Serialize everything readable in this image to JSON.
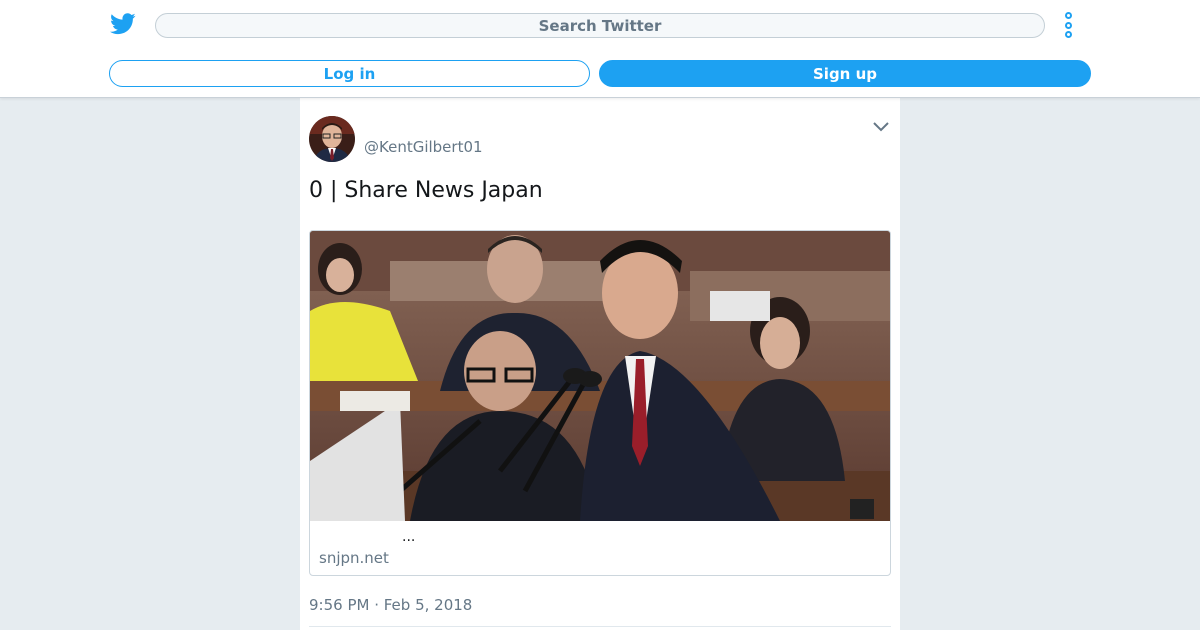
{
  "header": {
    "logo_icon": "twitter-bird-icon",
    "search_placeholder": "Search Twitter",
    "more_icon": "more-vertical-icon",
    "login_label": "Log in",
    "signup_label": "Sign up",
    "accent_color": "#1da1f2"
  },
  "tweet": {
    "avatar_icon": "avatar",
    "handle": "@KentGilbert01",
    "menu_icon": "chevron-down-icon",
    "text": "0 | Share News Japan",
    "card": {
      "image_icon": "preview-image",
      "description": "...",
      "domain": "snjpn.net"
    },
    "timestamp": "9:56 PM · Feb 5, 2018"
  }
}
